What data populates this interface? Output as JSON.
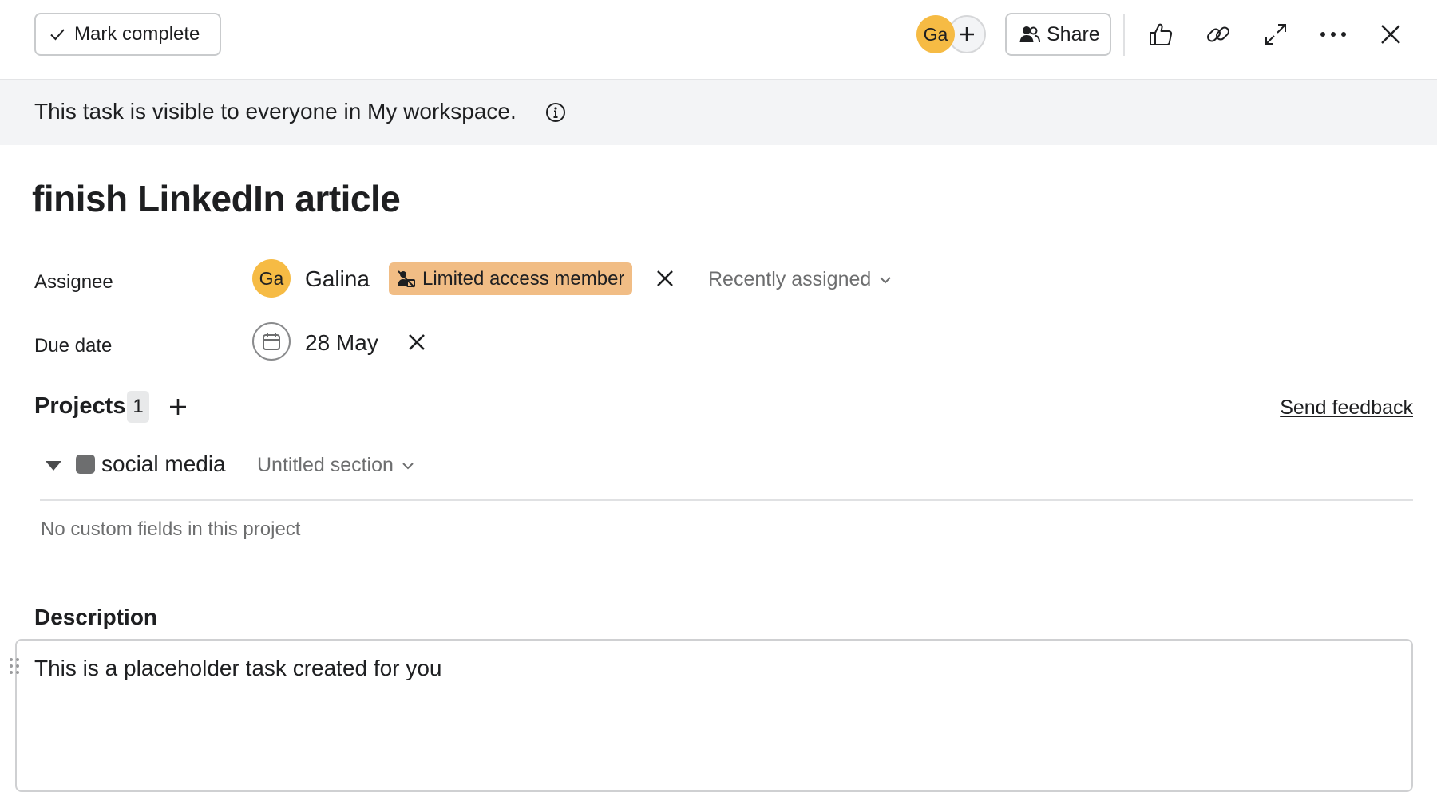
{
  "toolbar": {
    "mark_complete_label": "Mark complete",
    "collaborator_initials": "Ga",
    "share_label": "Share",
    "icons": [
      "check-icon",
      "plus-icon",
      "people-icon",
      "thumbs-up-icon",
      "link-icon",
      "expand-icon",
      "more-icon",
      "close-icon"
    ]
  },
  "banner": {
    "text": "This task is visible to everyone in My workspace.",
    "icon": "info-icon"
  },
  "task": {
    "title": "finish LinkedIn article"
  },
  "fields": {
    "assignee": {
      "label": "Assignee",
      "initials": "Ga",
      "name": "Galina",
      "badge": "Limited access member",
      "dropdown": "Recently assigned"
    },
    "due_date": {
      "label": "Due date",
      "value": "28 May"
    }
  },
  "projects": {
    "label": "Projects",
    "count": "1",
    "send_feedback": "Send feedback",
    "items": [
      {
        "name": "social media",
        "section": "Untitled section",
        "color": "#6d6e6f"
      }
    ],
    "no_custom_fields": "No custom fields in this project"
  },
  "description": {
    "label": "Description",
    "text": "This is a placeholder task created for you"
  },
  "colors": {
    "avatar": "#f6bb44",
    "limited_access_badge": "#f1bd85",
    "banner_bg": "#f3f4f6"
  }
}
